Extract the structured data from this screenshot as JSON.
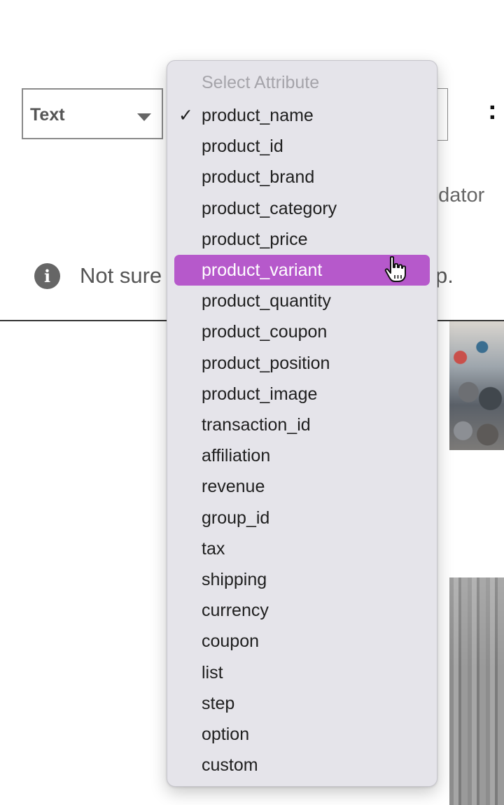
{
  "type_select": {
    "value": "Text"
  },
  "mandatory_fragment": "ndator",
  "info": {
    "text_start": "Not sure",
    "text_end": "p."
  },
  "dropdown": {
    "header": "Select Attribute",
    "selected": "product_name",
    "highlighted": "product_variant",
    "options": [
      "product_name",
      "product_id",
      "product_brand",
      "product_category",
      "product_price",
      "product_variant",
      "product_quantity",
      "product_coupon",
      "product_position",
      "product_image",
      "transaction_id",
      "affiliation",
      "revenue",
      "group_id",
      "tax",
      "shipping",
      "currency",
      "coupon",
      "list",
      "step",
      "option",
      "custom"
    ]
  },
  "colors": {
    "highlight": "#b659cb",
    "menu_background": "#e5e4ea"
  },
  "icons": {
    "info": "info-icon",
    "caret": "caret-down-icon",
    "check": "checkmark-icon",
    "cursor": "hand-pointer-icon"
  }
}
